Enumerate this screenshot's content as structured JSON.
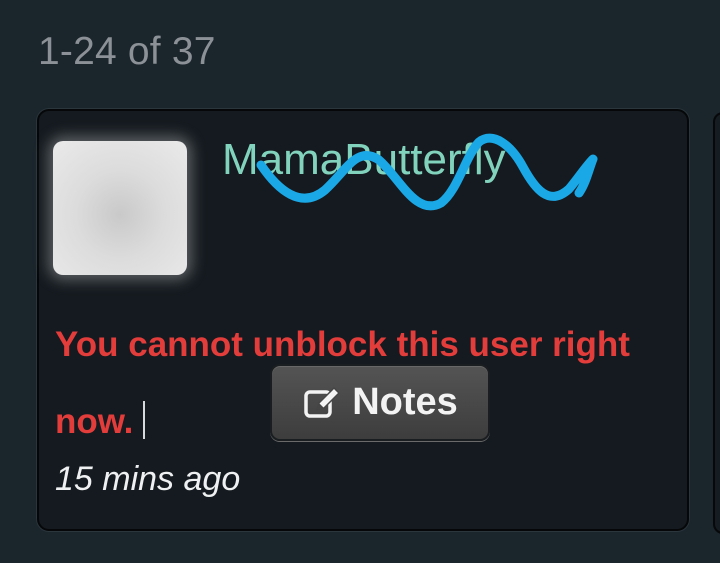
{
  "results": {
    "count_text": "1-24 of 37"
  },
  "card": {
    "username": "MamaButterfly",
    "message": "You cannot unblock this user right now.",
    "notes_label": "Notes",
    "timestamp": "15 mins ago",
    "icons": {
      "avatar": "avatar-placeholder",
      "notes": "edit-note-icon"
    }
  },
  "colors": {
    "background": "#1b252c",
    "card": "#141a1f",
    "username": "#82d3bd",
    "error": "#e23c3b",
    "scribble": "#1ba8e6"
  }
}
